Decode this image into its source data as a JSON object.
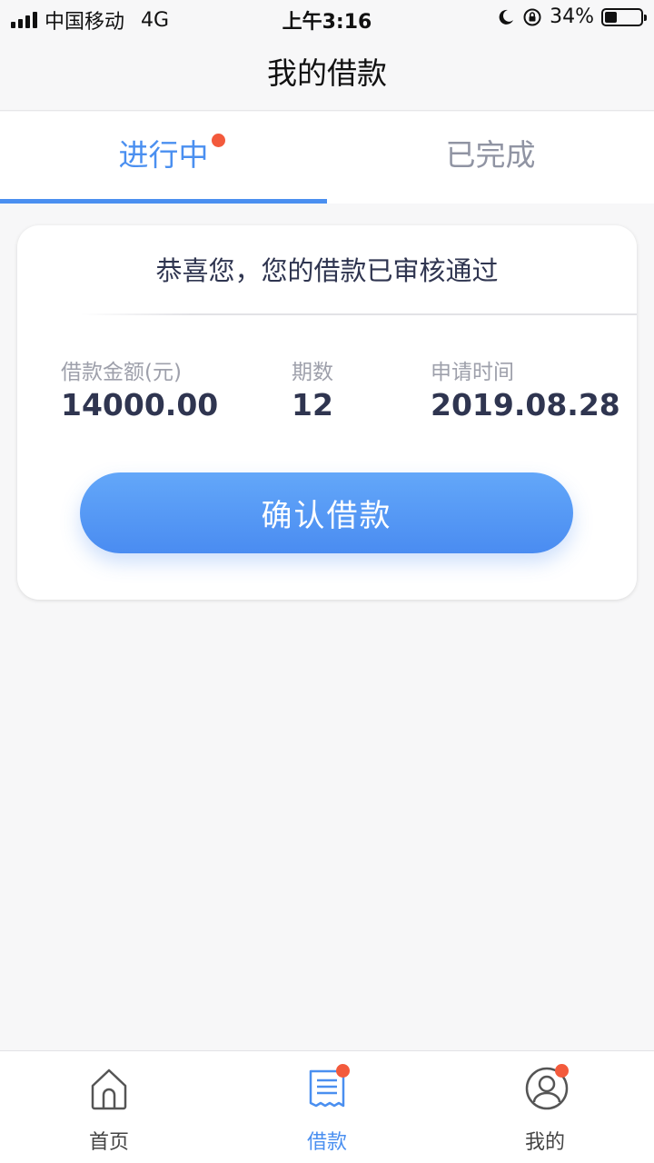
{
  "status_bar": {
    "carrier": "中国移动",
    "network": "4G",
    "time": "上午3:16",
    "battery": "34%",
    "battery_level": 0.34
  },
  "header": {
    "title": "我的借款"
  },
  "tabs": [
    {
      "label": "进行中",
      "active": true,
      "badge_dot": true
    },
    {
      "label": "已完成",
      "active": false
    }
  ],
  "card": {
    "title": "恭喜您，您的借款已审核通过",
    "fields": [
      {
        "label": "借款金额(元)",
        "value": "14000.00"
      },
      {
        "label": "期数",
        "value": "12"
      },
      {
        "label": "申请时间",
        "value": "2019.08.28"
      }
    ],
    "button_label": "确认借款"
  },
  "bottom_nav": [
    {
      "label": "首页",
      "icon": "home-icon",
      "active": false
    },
    {
      "label": "借款",
      "icon": "receipt-icon",
      "active": true,
      "badge_dot": true
    },
    {
      "label": "我的",
      "icon": "user-icon",
      "active": false,
      "badge_dot": true
    }
  ],
  "colors": {
    "accent": "#4a8ff0",
    "badge": "#f35a3c",
    "text_dark": "#2f3550",
    "text_muted": "#9094a3"
  }
}
